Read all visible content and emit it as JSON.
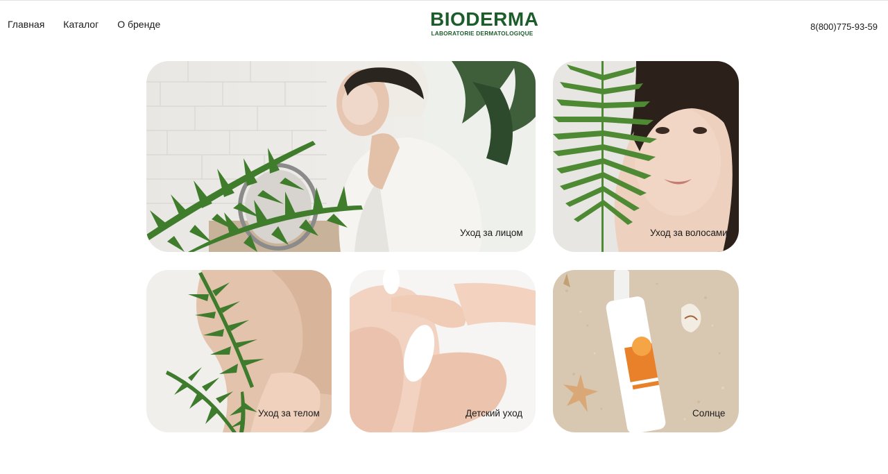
{
  "header": {
    "nav": [
      {
        "label": "Главная"
      },
      {
        "label": "Каталог"
      },
      {
        "label": "О бренде"
      }
    ],
    "logo": {
      "title": "BIODERMA",
      "subtitle": "LABORATORIE DERMATOLOGIQUE"
    },
    "phone": "8(800)775-93-59"
  },
  "categories": [
    {
      "label": "Уход за лицом"
    },
    {
      "label": "Уход за волосами"
    },
    {
      "label": "Уход за телом"
    },
    {
      "label": "Детский уход"
    },
    {
      "label": "Солнце"
    }
  ],
  "colors": {
    "brand_green": "#1d5d2b",
    "leaf_green": "#3f7d2c"
  }
}
